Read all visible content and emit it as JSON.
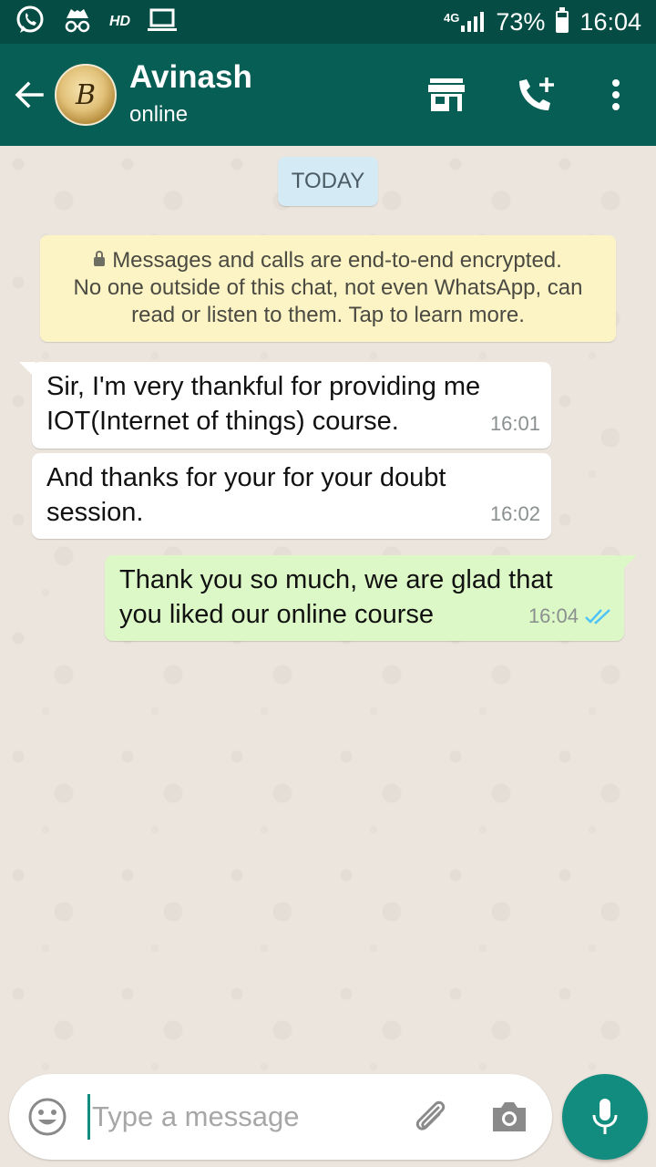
{
  "status_bar": {
    "network": "4G",
    "battery": "73%",
    "battery_level": 0.73,
    "time": "16:04",
    "hd_label": "HD",
    "icons": [
      "whatsapp-icon",
      "incognito-icon",
      "hd-icon",
      "laptop-icon",
      "signal-icon",
      "battery-icon"
    ]
  },
  "header": {
    "contact_name": "Avinash",
    "contact_status": "online",
    "avatar_letter": "B",
    "icons": [
      "back-arrow-icon",
      "store-icon",
      "add-call-icon",
      "more-vert-icon"
    ]
  },
  "chat": {
    "date_chip": "TODAY",
    "encryption_notice": {
      "line1": "Messages and calls are end-to-end encrypted.",
      "line2": "No one outside of this chat, not even WhatsApp, can",
      "line3": "read or listen to them. Tap to learn more."
    },
    "messages": [
      {
        "direction": "incoming",
        "line1": "Sir, I'm very thankful for providing me",
        "line2": "IOT(Internet of things) course.",
        "time": "16:01"
      },
      {
        "direction": "incoming",
        "line1": "And thanks for your for your doubt",
        "line2": "session.",
        "time": "16:02"
      },
      {
        "direction": "outgoing",
        "line1": "Thank you so much, we are glad that",
        "line2": "you liked our online course",
        "time": "16:04",
        "status": "read"
      }
    ]
  },
  "input_bar": {
    "placeholder": "Type a message",
    "value": "",
    "icons": [
      "emoji-icon",
      "attach-icon",
      "camera-icon",
      "mic-icon"
    ]
  },
  "colors": {
    "header": "#075e54",
    "status_bar": "#054d44",
    "outgoing_bubble": "#dcf8c6",
    "incoming_bubble": "#ffffff",
    "chat_background": "#ece5dd",
    "accent": "#128c7e",
    "read_ticks": "#4fc3f7",
    "date_chip": "#d4eaf4",
    "notice": "#fdf4c5"
  }
}
